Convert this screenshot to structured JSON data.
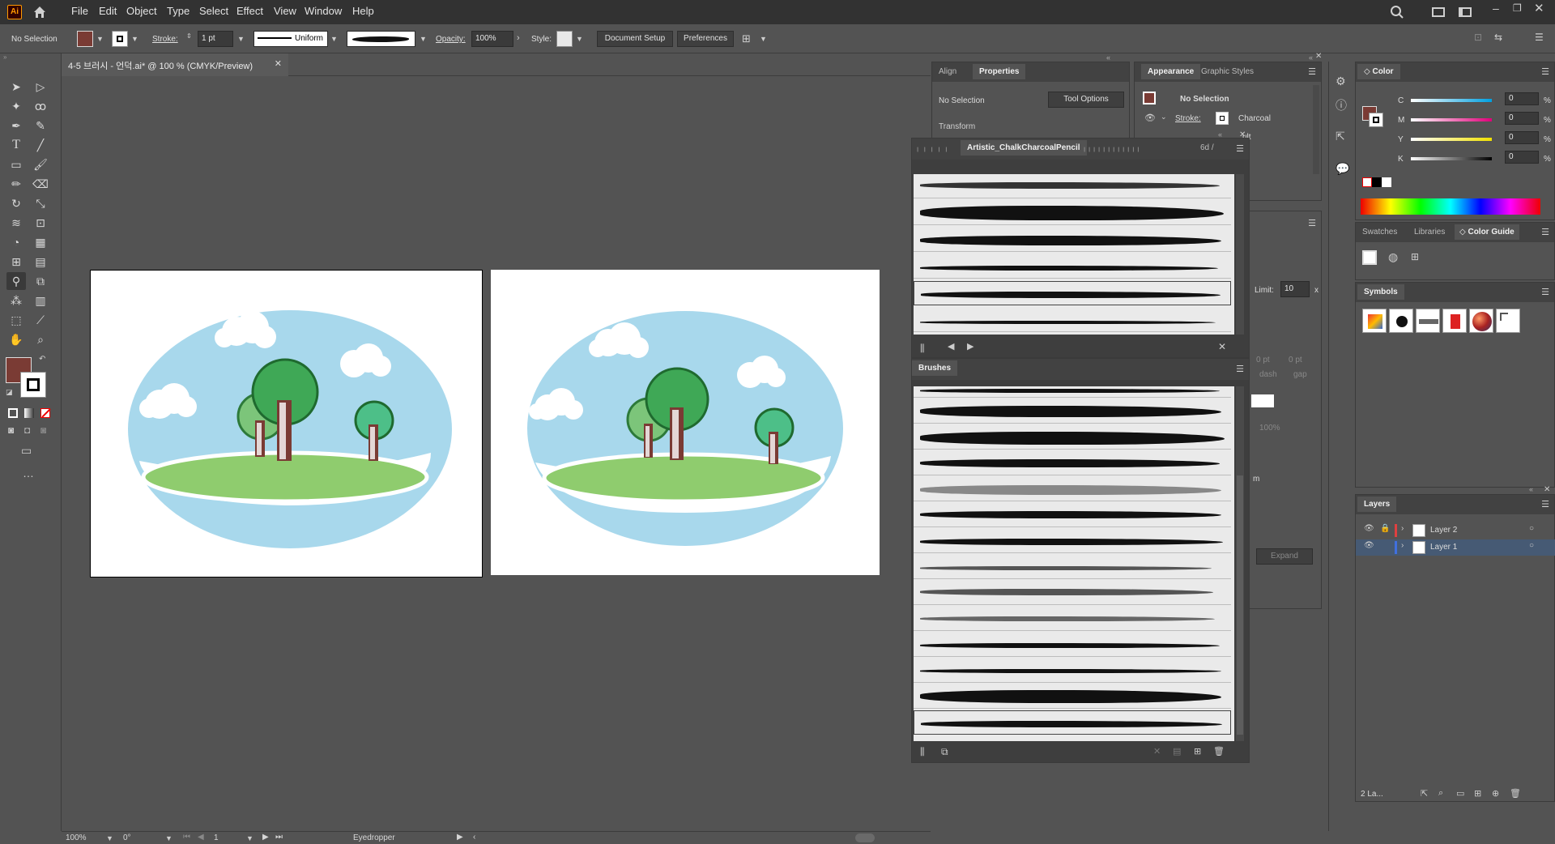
{
  "app": {
    "logo": "Ai"
  },
  "menu": [
    "File",
    "Edit",
    "Object",
    "Type",
    "Select",
    "Effect",
    "View",
    "Window",
    "Help"
  ],
  "control": {
    "selection": "No Selection",
    "stroke_label": "Stroke:",
    "stroke_value": "1 pt",
    "profile": "Uniform",
    "opacity_label": "Opacity:",
    "opacity_value": "100%",
    "style_label": "Style:",
    "document_setup": "Document Setup",
    "preferences": "Preferences"
  },
  "document": {
    "tab": "4-5 브러시 - 언덕.ai* @ 100 % (CMYK/Preview)"
  },
  "status": {
    "zoom": "100%",
    "angle": "0°",
    "artboard": "1",
    "tool": "Eyedropper"
  },
  "colors": {
    "fill": "#7a3b34",
    "sky": "#a8d8ec",
    "grass": "#8fcc6e",
    "tree_dark": "#3fa856",
    "tree_light": "#7cc57a",
    "trunk": "#7a3b34"
  },
  "align_panel": {
    "tabs": [
      "Align",
      "Properties"
    ],
    "selection": "No Selection",
    "tool_options": "Tool Options",
    "transform": "Transform"
  },
  "appearance_panel": {
    "tabs": [
      "Appearance",
      "Graphic Styles"
    ],
    "selection": "No Selection",
    "stroke_label": "Stroke:",
    "stroke_value": "Charcoal",
    "partial": "ult"
  },
  "library_panel": {
    "title": "Artistic_ChalkCharcoalPencil",
    "prefix": "6d /"
  },
  "brushes_panel": {
    "title": "Brushes"
  },
  "stroke_panel": {
    "limit_label": "Limit:",
    "limit_value": "10",
    "limit_unit": "x",
    "pt1": "0 pt",
    "pt2": "0 pt",
    "dash": "dash",
    "gap": "gap",
    "pct": "100%",
    "expand": "Expand",
    "m": "m"
  },
  "color_panel": {
    "title": "Color",
    "channels": [
      {
        "name": "C",
        "value": "0",
        "unit": "%"
      },
      {
        "name": "M",
        "value": "0",
        "unit": "%"
      },
      {
        "name": "Y",
        "value": "0",
        "unit": "%"
      },
      {
        "name": "K",
        "value": "0",
        "unit": "%"
      }
    ]
  },
  "swatch_tabs": [
    "Swatches",
    "Libraries",
    "Color Guide"
  ],
  "symbols_panel": {
    "title": "Symbols"
  },
  "layers_panel": {
    "title": "Layers",
    "layers": [
      "Layer 2",
      "Layer 1"
    ],
    "count": "2 La..."
  }
}
